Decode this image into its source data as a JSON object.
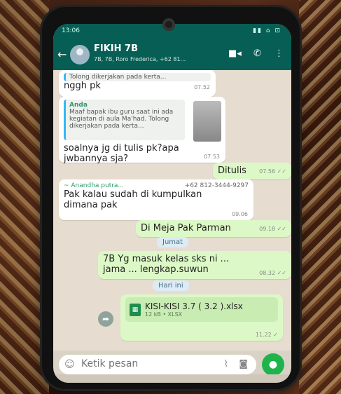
{
  "status": {
    "time": "13:06",
    "icons": "▮▮ ⌂ ⊡"
  },
  "header": {
    "title": "FIKIH 7B",
    "subtitle": "7B, 7B, Roro Frederica, +62 81..."
  },
  "messages": {
    "m1_quote_text": "Tolong dikerjakan pada kerta...",
    "m1_text": "nggh pk",
    "m1_time": "07.52",
    "m2_quote_author": "Anda",
    "m2_quote_text": "Maaf bapak ibu guru saat ini ada kegiatan di aula Ma'had. Tolong dikerjakan pada kerta...",
    "m2_text": "soalnya jg di tulis pk?apa jwbannya sja?",
    "m2_time": "07.53",
    "m3_text": "Ditulis",
    "m3_time": "07.56 ✓✓",
    "m4_author": "~ Anandha putra...",
    "m4_phone": "+62 812-3444-9297",
    "m4_text": "Pak kalau sudah di kumpulkan dimana pak",
    "m4_time": "09.06",
    "m5_text": "Di Meja Pak Parman",
    "m5_time": "09.18 ✓✓",
    "day1": "Jumat",
    "m6_text": "7B Yg masuk kelas sks ni ... jama ... lengkap.suwun",
    "m6_time": "08.32 ✓✓",
    "day2": "Hari ini",
    "m7_filename": "KISI-KISI 3.7 ( 3.2 ).xlsx",
    "m7_filemeta": "12 kB • XLSX",
    "m7_time": "11.22 ✓"
  },
  "composer": {
    "placeholder": "Ketik pesan"
  },
  "colors": {
    "header": "#075e54",
    "outgoing": "#dcf8c6",
    "mic": "#1fb34c"
  },
  "icons": {
    "back": "arrow-left-icon",
    "video": "video-icon",
    "call": "phone-icon",
    "menu": "more-vert-icon",
    "emoji": "emoji-icon",
    "attach": "paperclip-icon",
    "camera": "camera-icon",
    "mic": "mic-icon",
    "forward": "forward-icon"
  }
}
